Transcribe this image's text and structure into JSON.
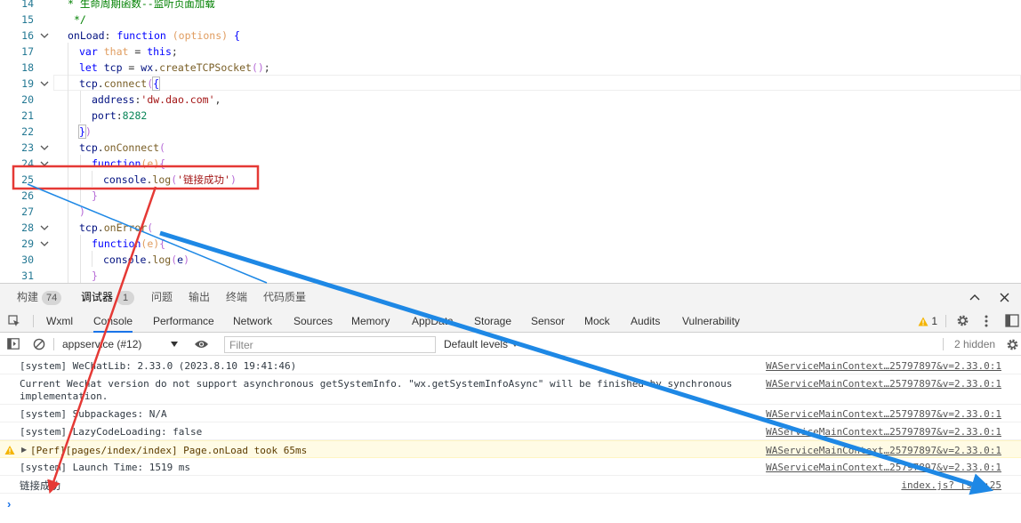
{
  "editor": {
    "lines": [
      {
        "n": "14",
        "fold": false
      },
      {
        "n": "15",
        "fold": false
      },
      {
        "n": "16",
        "fold": true
      },
      {
        "n": "17",
        "fold": false
      },
      {
        "n": "18",
        "fold": false
      },
      {
        "n": "19",
        "fold": true
      },
      {
        "n": "20",
        "fold": false
      },
      {
        "n": "21",
        "fold": false
      },
      {
        "n": "22",
        "fold": false
      },
      {
        "n": "23",
        "fold": true
      },
      {
        "n": "24",
        "fold": true
      },
      {
        "n": "25",
        "fold": false
      },
      {
        "n": "26",
        "fold": false
      },
      {
        "n": "27",
        "fold": false
      },
      {
        "n": "28",
        "fold": true
      },
      {
        "n": "29",
        "fold": true
      },
      {
        "n": "30",
        "fold": false
      },
      {
        "n": "31",
        "fold": false
      }
    ],
    "code": {
      "l14": "* 生命周期函数--监听页面加载",
      "l15": "*/",
      "l16_name": "onLoad",
      "l16_fn": "function",
      "l16_param": "(options)",
      "l17_var": "var",
      "l17_that": "that",
      "l17_this": "this",
      "l18_let": "let",
      "l18_tcp": "tcp",
      "l18_wx": "wx",
      "l18_create": "createTCPSocket",
      "l19_tcp": "tcp",
      "l19_connect": "connect",
      "l20_key": "address",
      "l20_val": "'dw.dao.com'",
      "l21_key": "port",
      "l21_val": "8282",
      "l23_tcp": "tcp",
      "l23_onconnect": "onConnect",
      "l24_fn": "function",
      "l24_e": "(e)",
      "l25_console": "console",
      "l25_log": "log",
      "l25_str": "'链接成功'",
      "l28_tcp": "tcp",
      "l28_onerror": "onError",
      "l29_fn": "function",
      "l29_e": "(e)",
      "l30_console": "console",
      "l30_log": "log",
      "l30_e": "e"
    }
  },
  "devtools": {
    "top_tabs": [
      {
        "label": "构建",
        "badge": "74"
      },
      {
        "label": "调试器",
        "badge": "1"
      },
      {
        "label": "问题"
      },
      {
        "label": "输出"
      },
      {
        "label": "终端"
      },
      {
        "label": "代码质量"
      }
    ],
    "panel_tabs": [
      "Wxml",
      "Console",
      "Performance",
      "Network",
      "Sources",
      "Memory",
      "AppData",
      "Storage",
      "Sensor",
      "Mock",
      "Audits",
      "Vulnerability"
    ],
    "warning_count": "1",
    "context_select": "appservice (#12)",
    "filter_placeholder": "Filter",
    "levels_select": "Default levels",
    "hidden_count": "2 hidden",
    "prompt_symbol": "›",
    "messages": [
      {
        "text": "[system] WeChatLib: 2.33.0 (2023.8.10 19:41:46)",
        "source": "WAServiceMainContext…25797897&v=2.33.0:1"
      },
      {
        "text": "Current Wechat version do not support asynchronous getSystemInfo. \"wx.getSystemInfoAsync\" will be finished by synchronous\nimplementation.",
        "source": "WAServiceMainContext…25797897&v=2.33.0:1"
      },
      {
        "text": "[system] Subpackages: N/A",
        "source": "WAServiceMainContext…25797897&v=2.33.0:1"
      },
      {
        "text": "[system] LazyCodeLoading: false",
        "source": "WAServiceMainContext…25797897&v=2.33.0:1"
      },
      {
        "text": "[Perf][pages/index/index] Page.onLoad took 65ms",
        "source": "WAServiceMainContext…25797897&v=2.33.0:1",
        "level": "warning"
      },
      {
        "text": "[system] Launch Time: 1519 ms",
        "source": "WAServiceMainContext…25797897&v=2.33.0:1"
      },
      {
        "text": "链接成功",
        "source": "index.js? [sm]:25"
      }
    ]
  },
  "annotations": {
    "box_color": "#e53935",
    "arrow_red": "#e53935",
    "arrow_blue": "#1e88e5"
  }
}
